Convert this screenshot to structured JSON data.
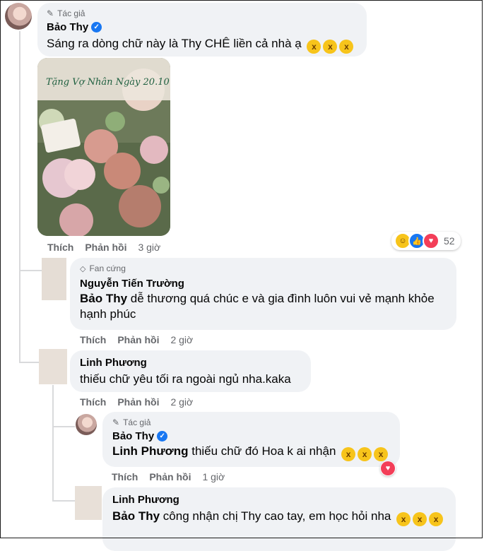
{
  "comments": [
    {
      "badge": "Tác giả",
      "author": "Bảo Thy",
      "text": "Sáng ra dòng chữ này là Thy CHÊ liền cả nhà ạ",
      "photo_caption": "Tặng Vợ Nhân Ngày 20.10",
      "actions": {
        "like": "Thích",
        "reply": "Phản hồi",
        "time": "3 giờ"
      },
      "reaction_count": "52"
    },
    {
      "badge": "Fan cứng",
      "author": "Nguyễn Tiến Trường",
      "mention": "Bảo Thy",
      "text": " dễ thương quá chúc e và gia đình luôn vui vẻ mạnh khỏe hạnh phúc",
      "actions": {
        "like": "Thích",
        "reply": "Phản hồi",
        "time": "2 giờ"
      }
    },
    {
      "author": "Linh Phương",
      "text": "thiếu chữ yêu tối ra ngoài ngủ nha.kaka",
      "actions": {
        "like": "Thích",
        "reply": "Phản hồi",
        "time": "2 giờ"
      }
    },
    {
      "badge": "Tác giả",
      "author": "Bảo Thy",
      "mention": "Linh Phương",
      "text": " thiếu chữ đó Hoa k ai nhận",
      "actions": {
        "like": "Thích",
        "reply": "Phản hồi",
        "time": "1 giờ"
      }
    },
    {
      "author": "Linh Phương",
      "mention": "Bảo Thy",
      "text": " công nhận chị Thy cao tay, em học hỏi nha"
    }
  ],
  "colors": {
    "bubble": "#f0f2f5",
    "meta": "#65676b",
    "verified": "#1877f2",
    "love": "#f33e58",
    "like": "#1877f2",
    "haha": "#f7c41b"
  },
  "icons": [
    "pencil-icon",
    "verified-icon",
    "diamond-icon",
    "haha-emoji",
    "laughing-emoji",
    "like-reaction-icon",
    "love-reaction-icon"
  ]
}
